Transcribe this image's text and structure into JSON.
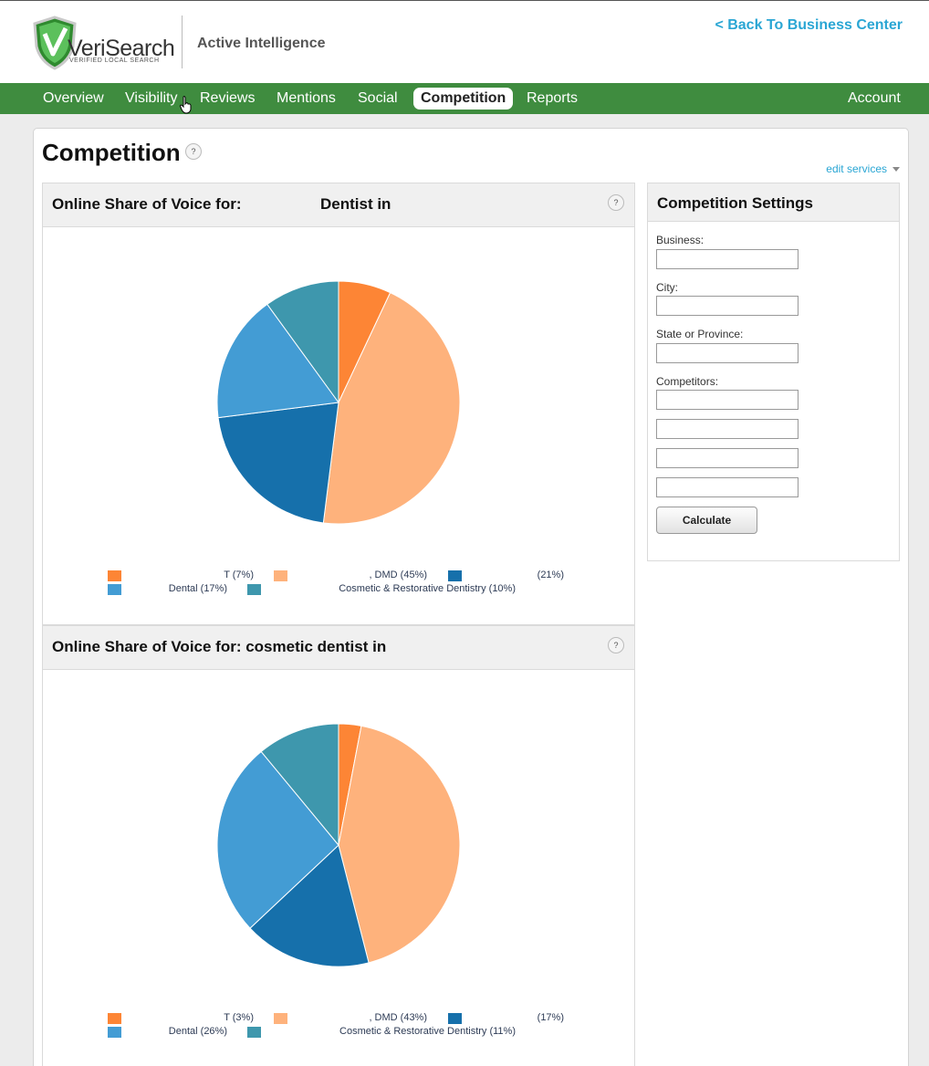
{
  "brand": {
    "logo_text": "VeriSearch",
    "logo_tagline": "VERIFIED LOCAL SEARCH",
    "product": "Active Intelligence",
    "back_link": "< Back To Business Center"
  },
  "nav": {
    "items": [
      {
        "label": "Overview",
        "active": false
      },
      {
        "label": "Visibility",
        "active": false
      },
      {
        "label": "Reviews",
        "active": false
      },
      {
        "label": "Mentions",
        "active": false
      },
      {
        "label": "Social",
        "active": false
      },
      {
        "label": "Competition",
        "active": true
      },
      {
        "label": "Reports",
        "active": false
      }
    ],
    "account": "Account"
  },
  "page": {
    "title": "Competition",
    "help": "?",
    "edit_services": "edit services"
  },
  "panels": [
    {
      "title": "Online Share of Voice for:",
      "title_extra": "Dentist in",
      "help": "?"
    },
    {
      "title": "Online Share of Voice for: cosmetic dentist in",
      "title_extra": "",
      "help": "?"
    }
  ],
  "chart_data": [
    {
      "type": "pie",
      "slices": [
        {
          "label": "T (7%)",
          "value": 7,
          "color": "#fd8535"
        },
        {
          "label": ", DMD (45%)",
          "value": 45,
          "color": "#feb27c"
        },
        {
          "label": "(21%)",
          "value": 21,
          "color": "#1670ab"
        },
        {
          "label": "Dental (17%)",
          "value": 17,
          "color": "#439cd4"
        },
        {
          "label": "Cosmetic & Restorative Dentistry (10%)",
          "value": 10,
          "color": "#3e97ad"
        }
      ]
    },
    {
      "type": "pie",
      "slices": [
        {
          "label": "T (3%)",
          "value": 3,
          "color": "#fd8535"
        },
        {
          "label": ", DMD (43%)",
          "value": 43,
          "color": "#feb27c"
        },
        {
          "label": "(17%)",
          "value": 17,
          "color": "#1670ab"
        },
        {
          "label": "Dental (26%)",
          "value": 26,
          "color": "#439cd4"
        },
        {
          "label": "Cosmetic & Restorative Dentistry (11%)",
          "value": 11,
          "color": "#3e97ad"
        }
      ]
    }
  ],
  "settings": {
    "title": "Competition Settings",
    "business_label": "Business:",
    "city_label": "City:",
    "state_label": "State or Province:",
    "competitors_label": "Competitors:",
    "calculate": "Calculate"
  },
  "colors": {
    "nav_green": "#3f8c3f",
    "link_blue": "#2aa6d4",
    "shield_green": "#3a9a3a"
  }
}
